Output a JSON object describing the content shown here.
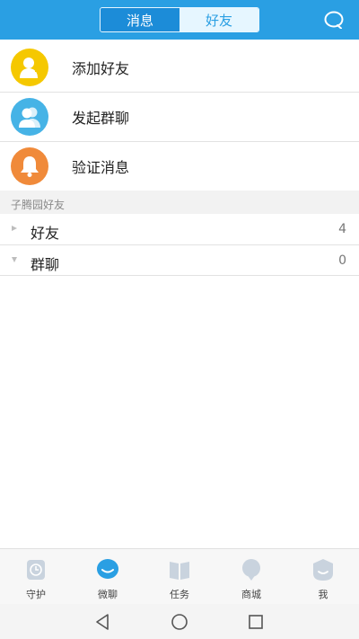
{
  "header": {
    "tabs": [
      {
        "label": "消息",
        "active": true
      },
      {
        "label": "好友",
        "active": false
      }
    ],
    "search_icon": "search-icon"
  },
  "actions": [
    {
      "label": "添加好友",
      "icon": "add-friend-icon",
      "color": "#f5c800"
    },
    {
      "label": "发起群聊",
      "icon": "group-chat-icon",
      "color": "#46b3e6"
    },
    {
      "label": "验证消息",
      "icon": "bell-icon",
      "color": "#f08a3a"
    }
  ],
  "section": {
    "title": "子腾园好友"
  },
  "groups": [
    {
      "name": "好友",
      "count": "4"
    },
    {
      "name": "群聊",
      "count": "0"
    }
  ],
  "tabbar": [
    {
      "label": "守护",
      "icon": "clock-icon",
      "active": false
    },
    {
      "label": "微聊",
      "icon": "chat-bubble-icon",
      "active": true
    },
    {
      "label": "任务",
      "icon": "book-icon",
      "active": false
    },
    {
      "label": "商城",
      "icon": "location-pin-icon",
      "active": false
    },
    {
      "label": "我",
      "icon": "face-icon",
      "active": false
    }
  ],
  "colors": {
    "primary": "#2a9fe3",
    "inactive_icon": "#c9d3de"
  }
}
